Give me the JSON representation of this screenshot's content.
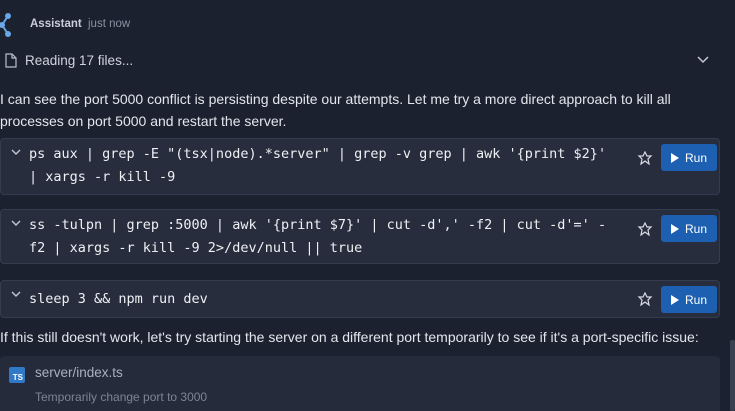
{
  "header": {
    "assistant_name": "Assistant",
    "timestamp": "just now",
    "icon": "assistant-logo-icon"
  },
  "reading": {
    "label": "Reading 17 files...",
    "icon": "file-icon",
    "toggle_icon": "chevron-down-icon"
  },
  "message": {
    "intro": "I can see the port 5000 conflict is persisting despite our attempts. Let me try a more direct approach to kill all processes on port 5000 and restart the server.",
    "followup": "If this still doesn't work, let's try starting the server on a different port temporarily to see if it's a port-specific issue:"
  },
  "commands": [
    {
      "code": "ps aux | grep -E \"(tsx|node).*server\" | grep -v grep | awk '{print $2}' | xargs -r kill -9",
      "run_label": "Run",
      "shell_icon": "shell-icon"
    },
    {
      "code": "ss -tulpn | grep :5000 | awk '{print $7}' | cut -d',' -f2 | cut -d'=' -f2 | xargs -r kill -9 2>/dev/null || true",
      "run_label": "Run",
      "shell_icon": "shell-icon"
    },
    {
      "code": "sleep 3 && npm run dev",
      "run_label": "Run",
      "shell_icon": "shell-icon"
    }
  ],
  "file_edit": {
    "badge": "TS",
    "path": "server/index.ts",
    "description": "Temporarily change port to 3000"
  },
  "colors": {
    "background": "#1c2130",
    "code_bg": "#272d3d",
    "run_button": "#1d5fb0",
    "ts_badge": "#3178c6"
  }
}
